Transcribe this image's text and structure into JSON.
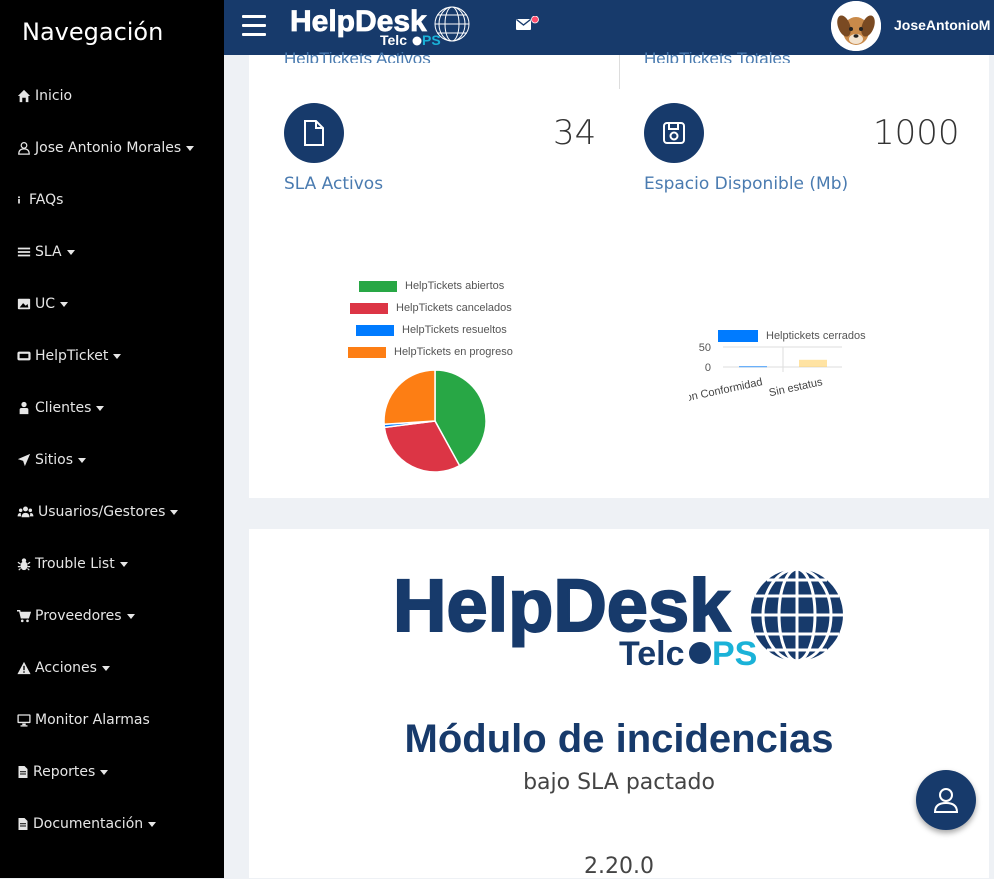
{
  "sidebar": {
    "title": "Navegación",
    "items": [
      {
        "label": "Inicio",
        "icon": "home-icon",
        "dropdown": false
      },
      {
        "label": "Jose Antonio Morales",
        "icon": "user-icon",
        "dropdown": true
      },
      {
        "label": "FAQs",
        "icon": "info-icon",
        "dropdown": false
      },
      {
        "label": "SLA",
        "icon": "list-icon",
        "dropdown": true
      },
      {
        "label": "UC",
        "icon": "image-icon",
        "dropdown": true
      },
      {
        "label": "HelpTicket",
        "icon": "ticket-icon",
        "dropdown": true
      },
      {
        "label": "Clientes",
        "icon": "client-icon",
        "dropdown": true
      },
      {
        "label": "Sitios",
        "icon": "location-arrow-icon",
        "dropdown": true
      },
      {
        "label": "Usuarios/Gestores",
        "icon": "users-icon",
        "dropdown": true
      },
      {
        "label": "Trouble List",
        "icon": "bug-icon",
        "dropdown": true
      },
      {
        "label": "Proveedores",
        "icon": "cart-icon",
        "dropdown": true
      },
      {
        "label": "Acciones",
        "icon": "warning-icon",
        "dropdown": true
      },
      {
        "label": "Monitor Alarmas",
        "icon": "monitor-icon",
        "dropdown": false
      },
      {
        "label": "Reportes",
        "icon": "file-icon",
        "dropdown": true
      },
      {
        "label": "Documentación",
        "icon": "file-icon",
        "dropdown": true
      }
    ]
  },
  "topbar": {
    "logo_main": "HelpDesk",
    "logo_sub_a": "Telc",
    "logo_sub_b": "PS",
    "username": "JoseAntonioM"
  },
  "stats": {
    "top_left_label": "HelpTickets Activos",
    "top_right_label": "HelpTickets Totales",
    "sla_value": "34",
    "sla_label": "SLA Activos",
    "space_value": "1000",
    "space_label": "Espacio Disponible (Mb)"
  },
  "chart_data": [
    {
      "type": "pie",
      "series": [
        {
          "name": "HelpTickets abiertos",
          "color": "#28a745",
          "value": 42
        },
        {
          "name": "HelpTickets cancelados",
          "color": "#dc3545",
          "value": 31
        },
        {
          "name": "HelpTickets resueltos",
          "color": "#007bff",
          "value": 1
        },
        {
          "name": "HelpTickets en progreso",
          "color": "#fd7e14",
          "value": 26
        }
      ]
    },
    {
      "type": "bar",
      "categories": [
        "Con Conformidad",
        "Sin estatus"
      ],
      "series": [
        {
          "name": "Helptickets cerrados",
          "color": "#007bff",
          "values": [
            2,
            18
          ]
        }
      ],
      "bar_colors": [
        "#007bff",
        "#ffd166"
      ],
      "yticks": [
        "50",
        "0"
      ],
      "ylim": [
        0,
        50
      ]
    }
  ],
  "module": {
    "logo_main": "HelpDesk",
    "logo_sub_a": "Telc",
    "logo_sub_b": "PS",
    "title": "Módulo de incidencias",
    "subtitle": "bajo SLA pactado",
    "version": "2.20.0"
  },
  "colors": {
    "navy": "#173a6b",
    "cyan": "#1ab2d8",
    "link": "#4a7bb0"
  }
}
